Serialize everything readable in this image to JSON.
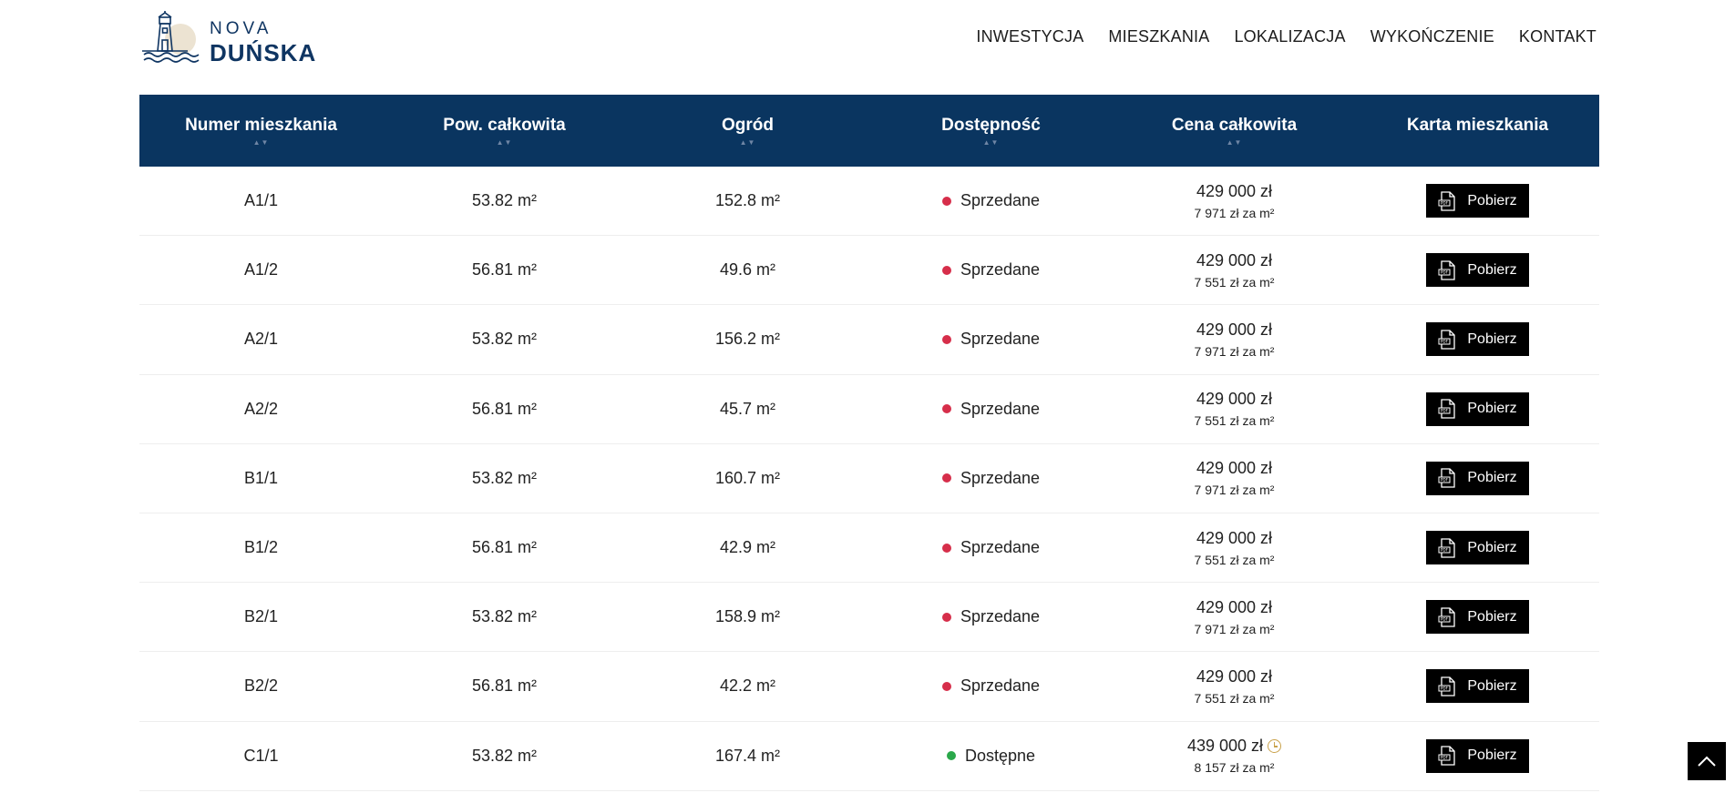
{
  "brand": {
    "line1": "NOVA",
    "line2": "DUŃSKA"
  },
  "nav": [
    {
      "label": "INWESTYCJA"
    },
    {
      "label": "MIESZKANIA"
    },
    {
      "label": "LOKALIZACJA"
    },
    {
      "label": "WYKOŃCZENIE"
    },
    {
      "label": "KONTAKT"
    }
  ],
  "colors": {
    "navy": "#0a3560",
    "sold": "#d62e4a",
    "available": "#2aa84a",
    "clock": "#c9a24b"
  },
  "table": {
    "headers": [
      {
        "label": "Numer mieszkania",
        "sortable": true
      },
      {
        "label": "Pow. całkowita",
        "sortable": true
      },
      {
        "label": "Ogród",
        "sortable": true
      },
      {
        "label": "Dostępność",
        "sortable": true
      },
      {
        "label": "Cena całkowita",
        "sortable": true
      },
      {
        "label": "Karta mieszkania",
        "sortable": false
      }
    ],
    "sort_glyph": "▲▼",
    "rows": [
      {
        "number": "A1/1",
        "area": "53.82 m²",
        "garden": "152.8 m²",
        "status": "Sprzedane",
        "status_type": "sold",
        "price": "429 000 zł",
        "price_per_m2": "7 971 zł za m²",
        "button": "Pobierz",
        "promo": false
      },
      {
        "number": "A1/2",
        "area": "56.81 m²",
        "garden": "49.6 m²",
        "status": "Sprzedane",
        "status_type": "sold",
        "price": "429 000 zł",
        "price_per_m2": "7 551 zł za m²",
        "button": "Pobierz",
        "promo": false
      },
      {
        "number": "A2/1",
        "area": "53.82 m²",
        "garden": "156.2 m²",
        "status": "Sprzedane",
        "status_type": "sold",
        "price": "429 000 zł",
        "price_per_m2": "7 971 zł za m²",
        "button": "Pobierz",
        "promo": false
      },
      {
        "number": "A2/2",
        "area": "56.81 m²",
        "garden": "45.7 m²",
        "status": "Sprzedane",
        "status_type": "sold",
        "price": "429 000 zł",
        "price_per_m2": "7 551 zł za m²",
        "button": "Pobierz",
        "promo": false
      },
      {
        "number": "B1/1",
        "area": "53.82 m²",
        "garden": "160.7 m²",
        "status": "Sprzedane",
        "status_type": "sold",
        "price": "429 000 zł",
        "price_per_m2": "7 971 zł za m²",
        "button": "Pobierz",
        "promo": false
      },
      {
        "number": "B1/2",
        "area": "56.81 m²",
        "garden": "42.9 m²",
        "status": "Sprzedane",
        "status_type": "sold",
        "price": "429 000 zł",
        "price_per_m2": "7 551 zł za m²",
        "button": "Pobierz",
        "promo": false
      },
      {
        "number": "B2/1",
        "area": "53.82 m²",
        "garden": "158.9 m²",
        "status": "Sprzedane",
        "status_type": "sold",
        "price": "429 000 zł",
        "price_per_m2": "7 971 zł za m²",
        "button": "Pobierz",
        "promo": false
      },
      {
        "number": "B2/2",
        "area": "56.81 m²",
        "garden": "42.2 m²",
        "status": "Sprzedane",
        "status_type": "sold",
        "price": "429 000 zł",
        "price_per_m2": "7 551 zł za m²",
        "button": "Pobierz",
        "promo": false
      },
      {
        "number": "C1/1",
        "area": "53.82 m²",
        "garden": "167.4 m²",
        "status": "Dostępne",
        "status_type": "available",
        "price": "439 000 zł",
        "price_per_m2": "8 157 zł za m²",
        "button": "Pobierz",
        "promo": true
      }
    ]
  },
  "icons": {
    "download": "pdf-file-icon",
    "promo": "clock-icon",
    "scroll": "chevron-up-icon",
    "logo": "lighthouse-icon"
  }
}
